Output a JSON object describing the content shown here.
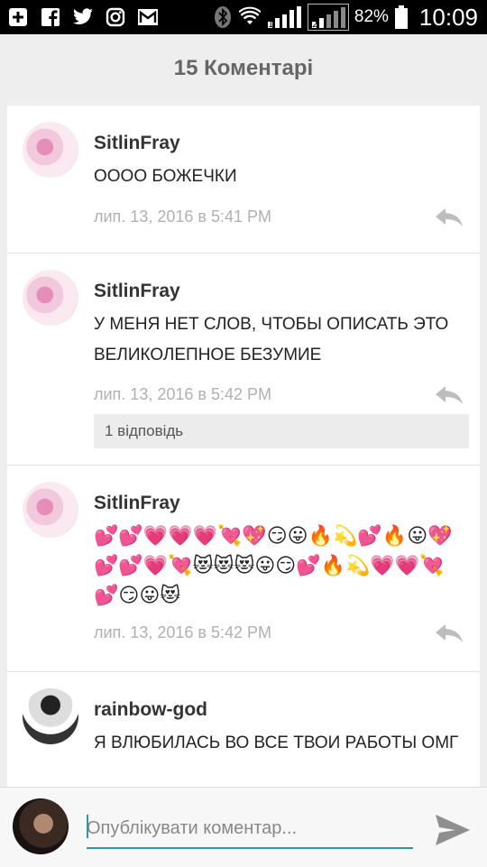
{
  "status_bar": {
    "battery_percent": "82%",
    "time": "10:09",
    "sim1_label": "1",
    "sim2_label": "2"
  },
  "header": {
    "title": "15 Коментарі"
  },
  "comments": [
    {
      "username": "SitlinFray",
      "text": "ОООО БОЖЕЧКИ",
      "time": "лип. 13, 2016 в 5:41 PM"
    },
    {
      "username": "SitlinFray",
      "text": "У МЕНЯ НЕТ СЛОВ, ЧТОБЫ ОПИСАТЬ ЭТО ВЕЛИКОЛЕПНОЕ БЕЗУМИЕ",
      "time": "лип. 13, 2016 в 5:42 PM",
      "replies_label": "1 відповідь"
    },
    {
      "username": "SitlinFray",
      "emoji_line1": "💕💕💗💗💗💘💖😏😛🔥💫💕🔥😛💖",
      "emoji_line2": "💕💕💗💘😻😻😻😛😏💕🔥💫💗💗💘",
      "emoji_line3": "💕😏😛😻",
      "time": "лип. 13, 2016 в 5:42 PM"
    },
    {
      "username": "rainbow-god",
      "text": "Я ВЛЮБИЛАСЬ ВО ВСЕ ТВОИ РАБОТЫ ОМГ"
    }
  ],
  "composer": {
    "placeholder": "Опублікувати коментар..."
  },
  "colors": {
    "accent": "#2a9aa3",
    "timestamp": "#b0b0b0",
    "title": "#666666"
  }
}
